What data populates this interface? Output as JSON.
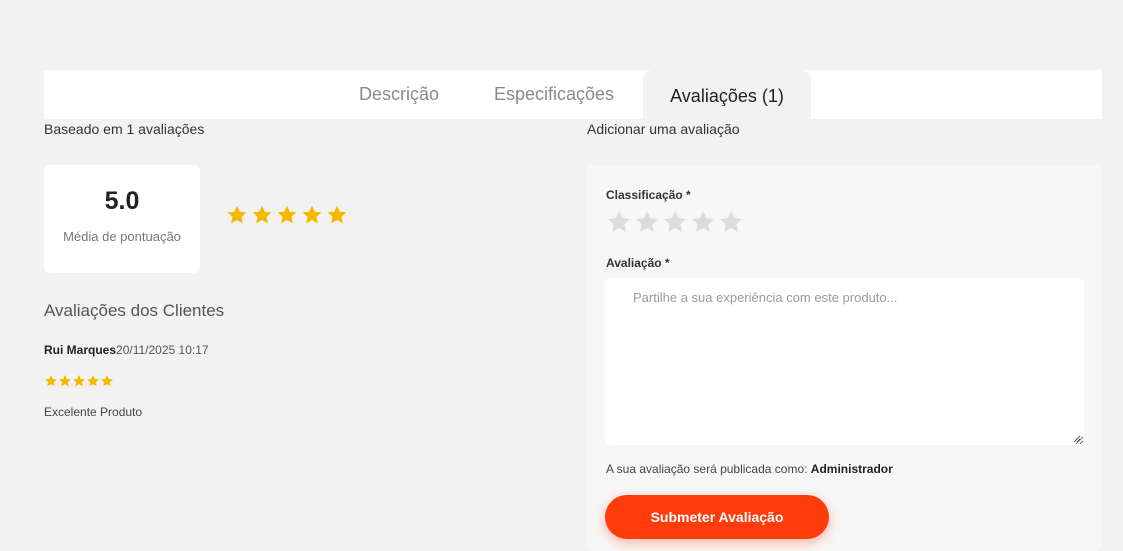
{
  "tabs": {
    "description": "Descrição",
    "specifications": "Especificações",
    "reviews": "Avaliações (1)"
  },
  "summary": {
    "based_on": "Baseado em 1 avaliações",
    "score": "5.0",
    "score_label": "Média de pontuação",
    "average_rating": 5,
    "max_rating": 5
  },
  "customer_reviews": {
    "title": "Avaliações dos Clientes",
    "items": [
      {
        "author": "Rui Marques",
        "date": "20/11/2025 10:17",
        "rating": 5,
        "text": "Excelente Produto"
      }
    ]
  },
  "form": {
    "title": "Adicionar uma avaliação",
    "rating_label": "Classificação *",
    "selected_rating": 0,
    "review_label": "Avaliação *",
    "review_placeholder": "Partilhe a sua experiência com este produto...",
    "review_value": "",
    "publish_prefix": "A sua avaliação será publicada como: ",
    "publish_name": "Administrador",
    "submit_label": "Submeter Avaliação"
  },
  "colors": {
    "star_filled": "#f5b800",
    "star_empty": "#dcdcdc",
    "accent": "#ff3c0c"
  },
  "icons": {
    "star": "star-icon",
    "resize": "resize-grip-icon"
  }
}
